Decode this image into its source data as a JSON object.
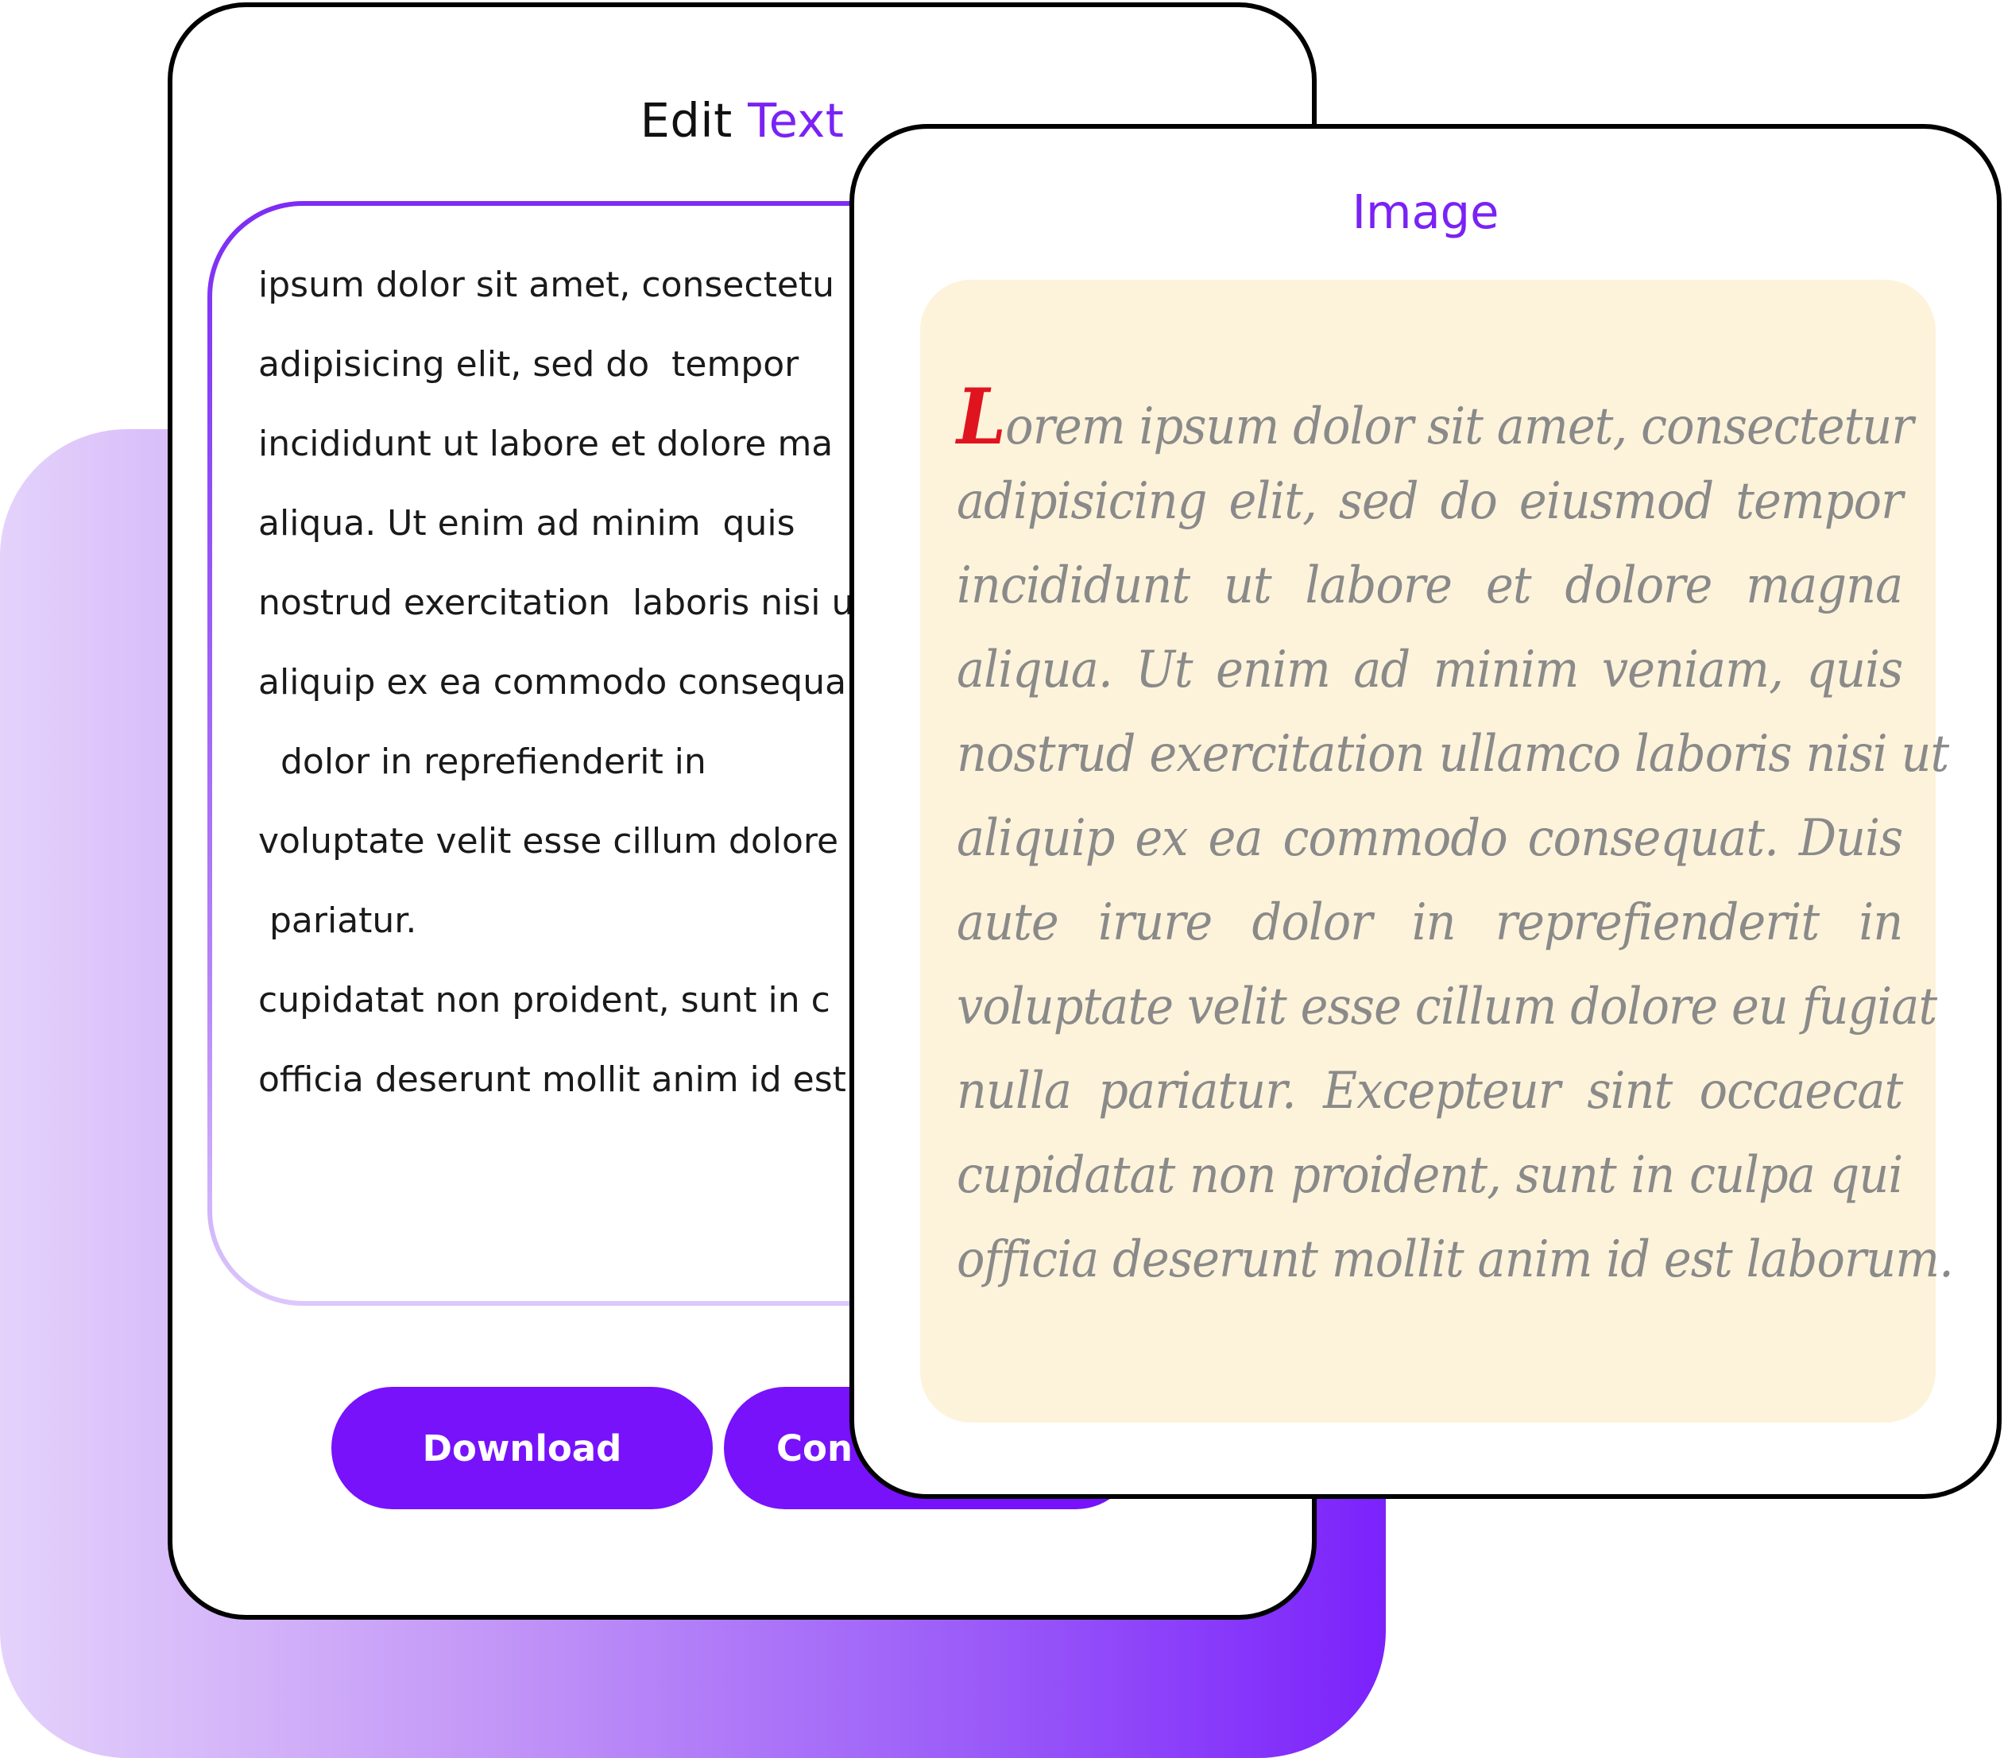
{
  "edit_card": {
    "title_main": "Edit",
    "title_accent": "Text",
    "lines": [
      "ipsum dolor sit amet, consectetu",
      "adipisicing elit, sed do  tempor",
      "incididunt ut labore et dolore ma",
      "aliqua. Ut enim ad minim  quis",
      "nostrud exercitation  laboris nisi u",
      "aliquip ex ea commodo consequa",
      "  dolor in reprefienderit in",
      "voluptate velit esse cillum dolore",
      " pariatur.",
      "cupidatat non proident, sunt in c",
      "officia deserunt mollit anim id est"
    ],
    "download_label": "Download",
    "convert_label": "Con"
  },
  "image_card": {
    "title": "Image",
    "dropcap": "L",
    "first_line_rest": "orem ipsum dolor sit amet, consectetur",
    "lines": [
      "adipisicing elit, sed do eiusmod tempor",
      "incididunt ut labore et dolore magna",
      "aliqua. Ut enim ad minim veniam, quis",
      "nostrud exercitation ullamco laboris nisi ut",
      "aliquip ex ea commodo consequat. Duis",
      "aute irure dolor in reprefienderit in",
      "voluptate velit esse cillum dolore eu fugiat",
      "nulla pariatur. Excepteur sint occaecat",
      "cupidatat non proident, sunt in culpa qui",
      "officia deserunt mollit anim id est laborum."
    ]
  },
  "colors": {
    "accent": "#7a22f5",
    "button": "#7712fb",
    "dropcap": "#e0141f",
    "parchment": "#fdf3da"
  }
}
